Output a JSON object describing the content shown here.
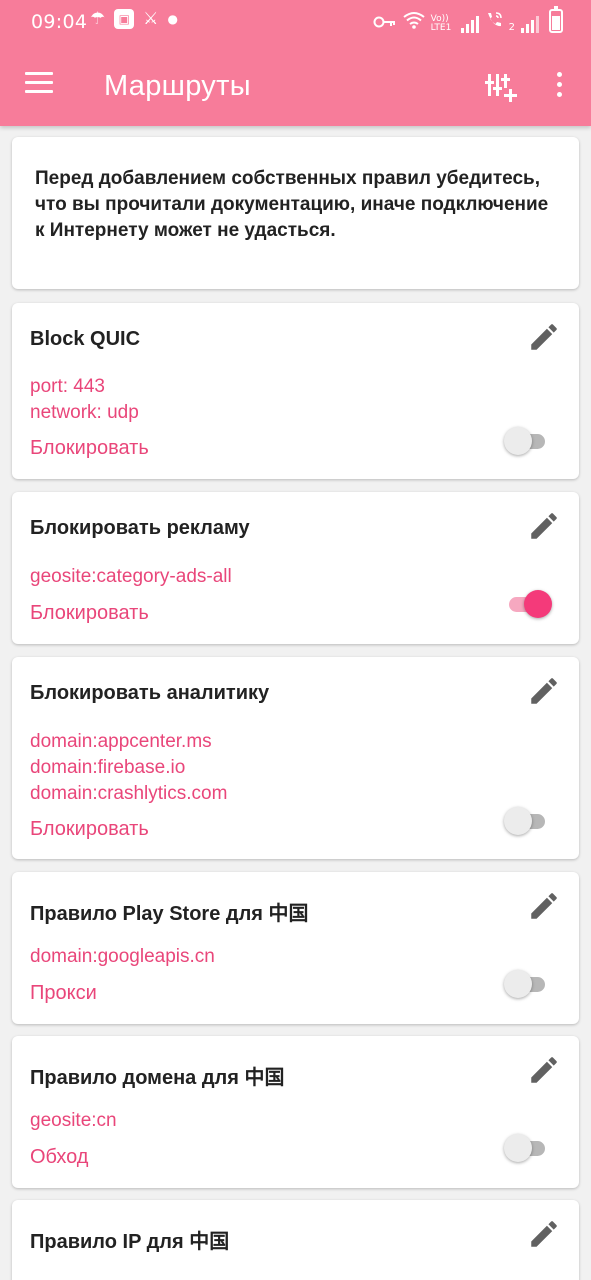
{
  "status_bar": {
    "time": "09:04",
    "left_icons": [
      "umbrella-icon",
      "app-badge-icon",
      "crossed-tools-icon",
      "dot-icon"
    ],
    "network_label": "Vo)) LTE1",
    "sim2_label": "2"
  },
  "app_bar": {
    "title": "Маршруты",
    "menu_icon": "menu-icon",
    "add_icon": "add-rule-icon",
    "more_icon": "more-vert-icon"
  },
  "notice": {
    "text": "Перед добавлением собственных правил убедитесь, что вы прочитали документацию, иначе подключение к Интернету может не удасться."
  },
  "rules": [
    {
      "title": "Block QUIC",
      "lines": [
        "port: 443",
        "network: udp"
      ],
      "action": "Блокировать",
      "enabled": false
    },
    {
      "title": "Блокировать рекламу",
      "lines": [
        "geosite:category-ads-all"
      ],
      "action": "Блокировать",
      "enabled": true
    },
    {
      "title": "Блокировать аналитику",
      "lines": [
        "domain:appcenter.ms",
        "domain:firebase.io",
        "domain:crashlytics.com"
      ],
      "action": "Блокировать",
      "enabled": false
    },
    {
      "title": "Правило Play Store для 中国",
      "lines": [
        "domain:googleapis.cn"
      ],
      "action": "Прокси",
      "enabled": false
    },
    {
      "title": "Правило домена для 中国",
      "lines": [
        "geosite:cn"
      ],
      "action": "Обход",
      "enabled": false
    },
    {
      "title": "Правило IP для 中国"
    }
  ],
  "colors": {
    "app_bar": "#f77c9a",
    "accent_text": "#e9467a",
    "switch_on": "#f43a7a",
    "background": "#f1f1f1"
  }
}
